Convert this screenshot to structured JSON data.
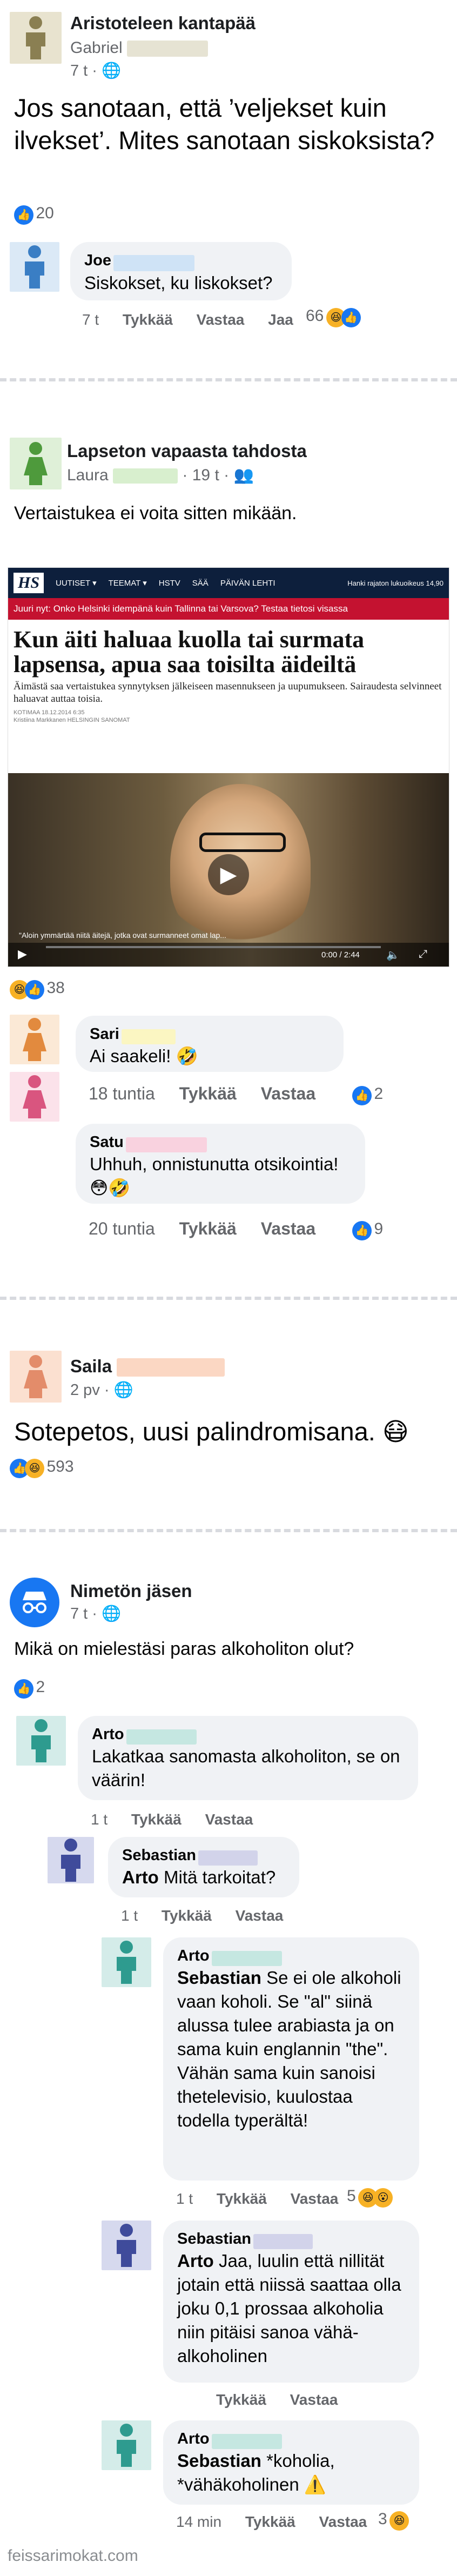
{
  "post1": {
    "group": "Aristoteleen kantapää",
    "author": "Gabriel",
    "time": "7 t ·",
    "text": "Jos sanotaan, että ’veljekset kuin ilvekset’. Mites sanotaan siskoksista?",
    "reaction_count": "20",
    "comment": {
      "name": "Joe",
      "text": "Siskokset, ku liskokset?",
      "time": "7 t",
      "like": "Tykkää",
      "reply": "Vastaa",
      "share": "Jaa",
      "reaction_count": "66"
    }
  },
  "post2": {
    "group": "Lapseton vapaasta tahdosta",
    "author": "Laura",
    "time": "· 19 t ·",
    "text": "Vertaistukea ei voita sitten mikään.",
    "news": {
      "logo": "HS",
      "nav": [
        "UUTISET ▾",
        "TEEMAT ▾",
        "HSTV",
        "SÄÄ",
        "PÄIVÄN LEHTI"
      ],
      "nav_right": "Hanki rajaton lukuoikeus 14,90",
      "ticker": "Juuri nyt: Onko Helsinki idempänä kuin Tallinna tai Varsova? Testaa tietosi visassa",
      "headline": "Kun äiti haluaa kuolla tai surmata lapsensa, apua saa toisilta äideiltä",
      "lead": "Äimästä saa vertaistukea synnytyksen jälkeiseen masennukseen ja uupumukseen. Sairaudesta selvinneet haluavat auttaa toisia.",
      "date": "KOTIMAA 18.12.2014 6:35",
      "byline": "Kristiina Markkanen HELSINGIN SANOMAT",
      "caption": "\"Aloin ymmärtää niitä äitejä, jotka ovat surmanneet omat lap...",
      "duration": "0:00 / 2:44"
    },
    "reaction_count": "38",
    "comments": [
      {
        "name": "Sari",
        "text": "Ai saakeli! 🤣",
        "time": "18 tuntia",
        "like": "Tykkää",
        "reply": "Vastaa",
        "reaction_count": "2"
      },
      {
        "name": "Satu",
        "text": "Uhhuh, onnistunutta otsikointia! 😳🤣",
        "time": "20 tuntia",
        "like": "Tykkää",
        "reply": "Vastaa",
        "reaction_count": "9"
      }
    ]
  },
  "post3": {
    "author": "Saila",
    "time": "2 pv ·",
    "text": "Sotepetos, uusi palindromisana. 😷",
    "reaction_count": "593"
  },
  "post4": {
    "author": "Nimetön jäsen",
    "time": "7 t ·",
    "text": "Mikä on mielestäsi paras alkoholiton olut?",
    "reaction_count": "2",
    "comments": [
      {
        "name": "Arto",
        "text": "Lakatkaa sanomasta alkoholiton, se on väärin!",
        "time": "1 t",
        "like": "Tykkää",
        "reply": "Vastaa"
      },
      {
        "name": "Sebastian",
        "mention": "Arto",
        "text": "Mitä tarkoitat?",
        "time": "1 t",
        "like": "Tykkää",
        "reply": "Vastaa"
      },
      {
        "name": "Arto",
        "mention": "Sebastian",
        "text": "Se ei ole alkoholi vaan koholi. Se \"al\" siinä alussa tulee arabiasta ja on sama kuin englannin \"the\". Vähän sama kuin sanoisi thetelevisio, kuulostaa todella typerältä!",
        "time": "1 t",
        "like": "Tykkää",
        "reply": "Vastaa",
        "reaction_count": "5"
      },
      {
        "name": "Sebastian",
        "mention": "Arto",
        "text": "Jaa, luulin että nillität jotain että niissä saattaa olla joku 0,1 prossaa alkoholia niin pitäisi sanoa vähä-alkoholinen",
        "like": "Tykkää",
        "reply": "Vastaa"
      },
      {
        "name": "Arto",
        "mention": "Sebastian",
        "text": "*koholia, *vähäkoholinen ⚠️",
        "time": "14 min",
        "like": "Tykkää",
        "reply": "Vastaa",
        "reaction_count": "3"
      }
    ]
  },
  "footer": "feissarimokat.com",
  "colors": {
    "like_blue": "#1877f2",
    "bubble": "#f0f2f5",
    "meta": "#65676b",
    "hs_red": "#c41230",
    "hs_dark": "#0d1f3c"
  }
}
